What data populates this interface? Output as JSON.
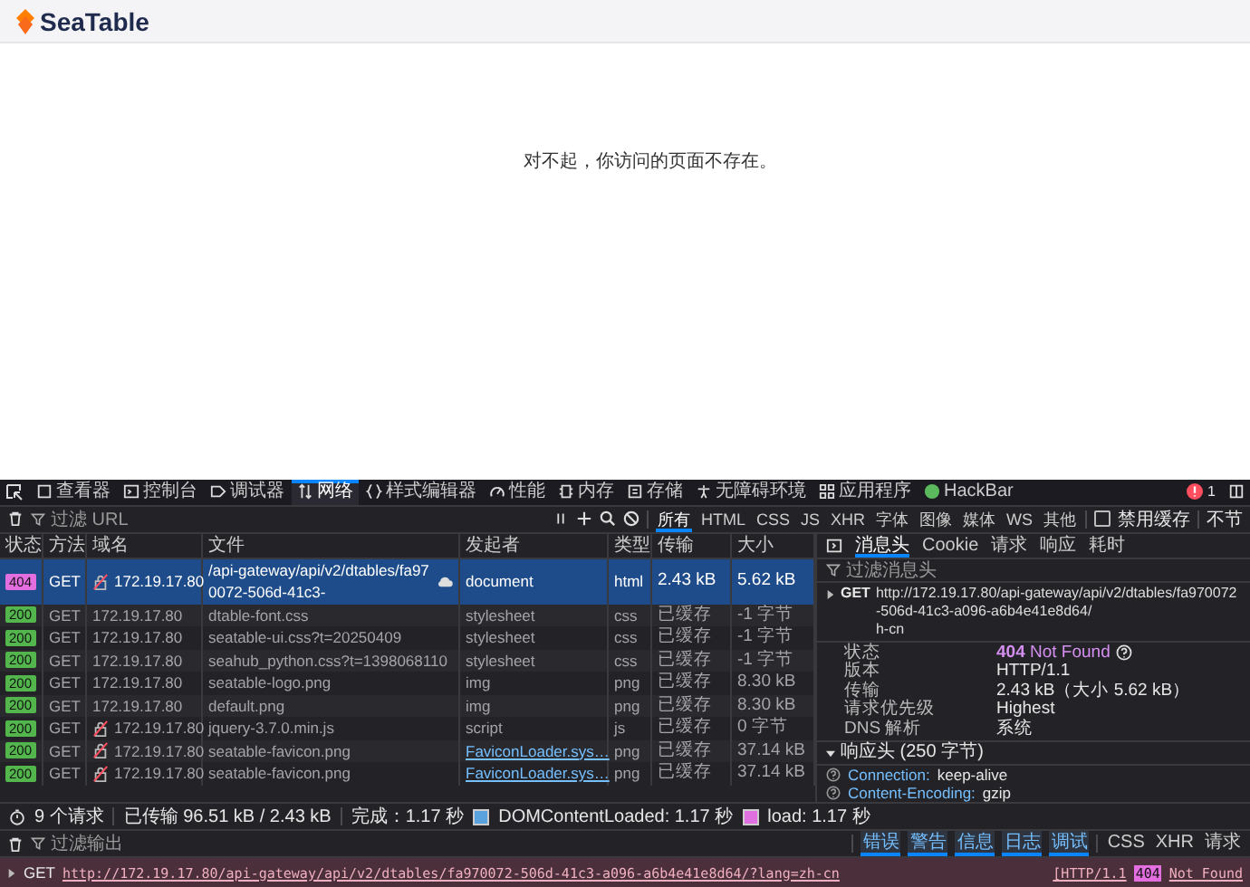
{
  "page": {
    "logo_text": "SeaTable",
    "message": "对不起，你访问的页面不存在。"
  },
  "devtools": {
    "tabs": [
      {
        "label": "查看器",
        "selected": false
      },
      {
        "label": "控制台",
        "selected": false
      },
      {
        "label": "调试器",
        "selected": false
      },
      {
        "label": "网络",
        "selected": true
      },
      {
        "label": "样式编辑器",
        "selected": false
      },
      {
        "label": "性能",
        "selected": false
      },
      {
        "label": "内存",
        "selected": false
      },
      {
        "label": "存储",
        "selected": false
      },
      {
        "label": "无障碍环境",
        "selected": false
      },
      {
        "label": "应用程序",
        "selected": false
      },
      {
        "label": "HackBar",
        "selected": false
      }
    ],
    "error_count": "1"
  },
  "network": {
    "filter_placeholder": "过滤 URL",
    "type_filters": [
      {
        "label": "所有",
        "selected": true
      },
      {
        "label": "HTML",
        "selected": false
      },
      {
        "label": "CSS",
        "selected": false
      },
      {
        "label": "JS",
        "selected": false
      },
      {
        "label": "XHR",
        "selected": false
      },
      {
        "label": "字体",
        "selected": false
      },
      {
        "label": "图像",
        "selected": false
      },
      {
        "label": "媒体",
        "selected": false
      },
      {
        "label": "WS",
        "selected": false
      },
      {
        "label": "其他",
        "selected": false
      }
    ],
    "disable_cache": {
      "label": "禁用缓存",
      "checked": false
    },
    "throttle_label": "不节",
    "columns": [
      "状态",
      "方法",
      "域名",
      "文件",
      "发起者",
      "类型",
      "传输",
      "大小"
    ],
    "rows": [
      {
        "status": "404",
        "color": "#e36ee0",
        "method": "GET",
        "domain": "172.19.17.80",
        "insecure": true,
        "file": "/api-gateway/api/v2/dtables/fa970072-506d-41c3-",
        "initiator_icon": true,
        "initiator": "document",
        "initiator_link": false,
        "type": "html",
        "transferred": "2.43 kB",
        "size": "5.62 kB",
        "cached": false,
        "selected": true
      },
      {
        "status": "200",
        "color": "#52b64c",
        "method": "GET",
        "domain": "172.19.17.80",
        "insecure": false,
        "file": "dtable-font.css",
        "initiator_icon": false,
        "initiator": "stylesheet",
        "initiator_link": false,
        "type": "css",
        "transferred": "已缓存",
        "size": "-1 字节",
        "cached": true,
        "selected": false
      },
      {
        "status": "200",
        "color": "#52b64c",
        "method": "GET",
        "domain": "172.19.17.80",
        "insecure": false,
        "file": "seatable-ui.css?t=20250409",
        "initiator_icon": false,
        "initiator": "stylesheet",
        "initiator_link": false,
        "type": "css",
        "transferred": "已缓存",
        "size": "-1 字节",
        "cached": true,
        "selected": false
      },
      {
        "status": "200",
        "color": "#52b64c",
        "method": "GET",
        "domain": "172.19.17.80",
        "insecure": false,
        "file": "seahub_python.css?t=1398068110",
        "initiator_icon": false,
        "initiator": "stylesheet",
        "initiator_link": false,
        "type": "css",
        "transferred": "已缓存",
        "size": "-1 字节",
        "cached": true,
        "selected": false
      },
      {
        "status": "200",
        "color": "#52b64c",
        "method": "GET",
        "domain": "172.19.17.80",
        "insecure": false,
        "file": "seatable-logo.png",
        "initiator_icon": false,
        "initiator": "img",
        "initiator_link": false,
        "type": "png",
        "transferred": "已缓存",
        "size": "8.30 kB",
        "cached": true,
        "selected": false
      },
      {
        "status": "200",
        "color": "#52b64c",
        "method": "GET",
        "domain": "172.19.17.80",
        "insecure": false,
        "file": "default.png",
        "initiator_icon": false,
        "initiator": "img",
        "initiator_link": false,
        "type": "png",
        "transferred": "已缓存",
        "size": "8.30 kB",
        "cached": true,
        "selected": false
      },
      {
        "status": "200",
        "color": "#52b64c",
        "method": "GET",
        "domain": "172.19.17.80",
        "insecure": true,
        "file": "jquery-3.7.0.min.js",
        "initiator_icon": false,
        "initiator": "script",
        "initiator_link": false,
        "type": "js",
        "transferred": "已缓存",
        "size": "0 字节",
        "cached": true,
        "selected": false
      },
      {
        "status": "200",
        "color": "#52b64c",
        "method": "GET",
        "domain": "172.19.17.80",
        "insecure": true,
        "file": "seatable-favicon.png",
        "initiator_icon": false,
        "initiator": "FaviconLoader.sys…",
        "initiator_link": true,
        "type": "png",
        "transferred": "已缓存",
        "size": "37.14 kB",
        "cached": true,
        "selected": false
      },
      {
        "status": "200",
        "color": "#52b64c",
        "method": "GET",
        "domain": "172.19.17.80",
        "insecure": true,
        "file": "seatable-favicon.png",
        "initiator_icon": false,
        "initiator": "FaviconLoader.sys…",
        "initiator_link": true,
        "type": "png",
        "transferred": "已缓存",
        "size": "37.14 kB",
        "cached": true,
        "selected": false
      }
    ],
    "summary": {
      "requests": "9 个请求",
      "transferred": "已传输 96.51 kB / 2.43 kB",
      "finish": "完成：1.17 秒",
      "dom_loaded": "DOMContentLoaded: 1.17 秒",
      "load": "load: 1.17 秒"
    }
  },
  "details": {
    "tabs": [
      {
        "label": "消息头",
        "selected": true
      },
      {
        "label": "Cookie",
        "selected": false
      },
      {
        "label": "请求",
        "selected": false
      },
      {
        "label": "响应",
        "selected": false
      },
      {
        "label": "耗时",
        "selected": false
      }
    ],
    "filter_placeholder": "过滤消息头",
    "request_method": "GET",
    "url_lines": [
      "http://172.19.17.80/api-gateway/api/v2/dtables/fa970072-506d-41c3-a096-a6b4e41e8d64/",
      "h-cn"
    ],
    "fields": [
      {
        "kind": "status",
        "label": "状态",
        "value": "**404** Not Found"
      },
      {
        "kind": "text",
        "label": "版本",
        "value": "HTTP/1.1"
      },
      {
        "kind": "text",
        "label": "传输",
        "value": "2.43 kB（大小 5.62 kB）"
      },
      {
        "kind": "text",
        "label": "请求优先级",
        "value": "Highest"
      },
      {
        "kind": "text",
        "label": "DNS 解析",
        "value": "系统"
      }
    ],
    "response_headers": {
      "title": "响应头 (250 字节)",
      "expanded": true,
      "headers": [
        {
          "name": "Connection:",
          "value": "keep-alive"
        },
        {
          "name": "Content-Encoding:",
          "value": "gzip"
        }
      ]
    }
  },
  "console": {
    "filter_placeholder": "过滤输出",
    "levels": [
      {
        "label": "错误",
        "on": true
      },
      {
        "label": "警告",
        "on": true
      },
      {
        "label": "信息",
        "on": true
      },
      {
        "label": "日志",
        "on": true
      },
      {
        "label": "调试",
        "on": true
      }
    ],
    "extra_filters": [
      {
        "label": "CSS",
        "on": false
      },
      {
        "label": "XHR",
        "on": false
      },
      {
        "label": "请求",
        "on": false
      }
    ],
    "messages": [
      {
        "method": "GET",
        "url": "http://172.19.17.80/api-gateway/api/v2/dtables/fa970072-506d-41c3-a096-a6b4e41e8d64/?lang=zh-cn",
        "protocol": "[HTTP/1.1",
        "status": "404",
        "status_text": "Not Found"
      }
    ]
  }
}
